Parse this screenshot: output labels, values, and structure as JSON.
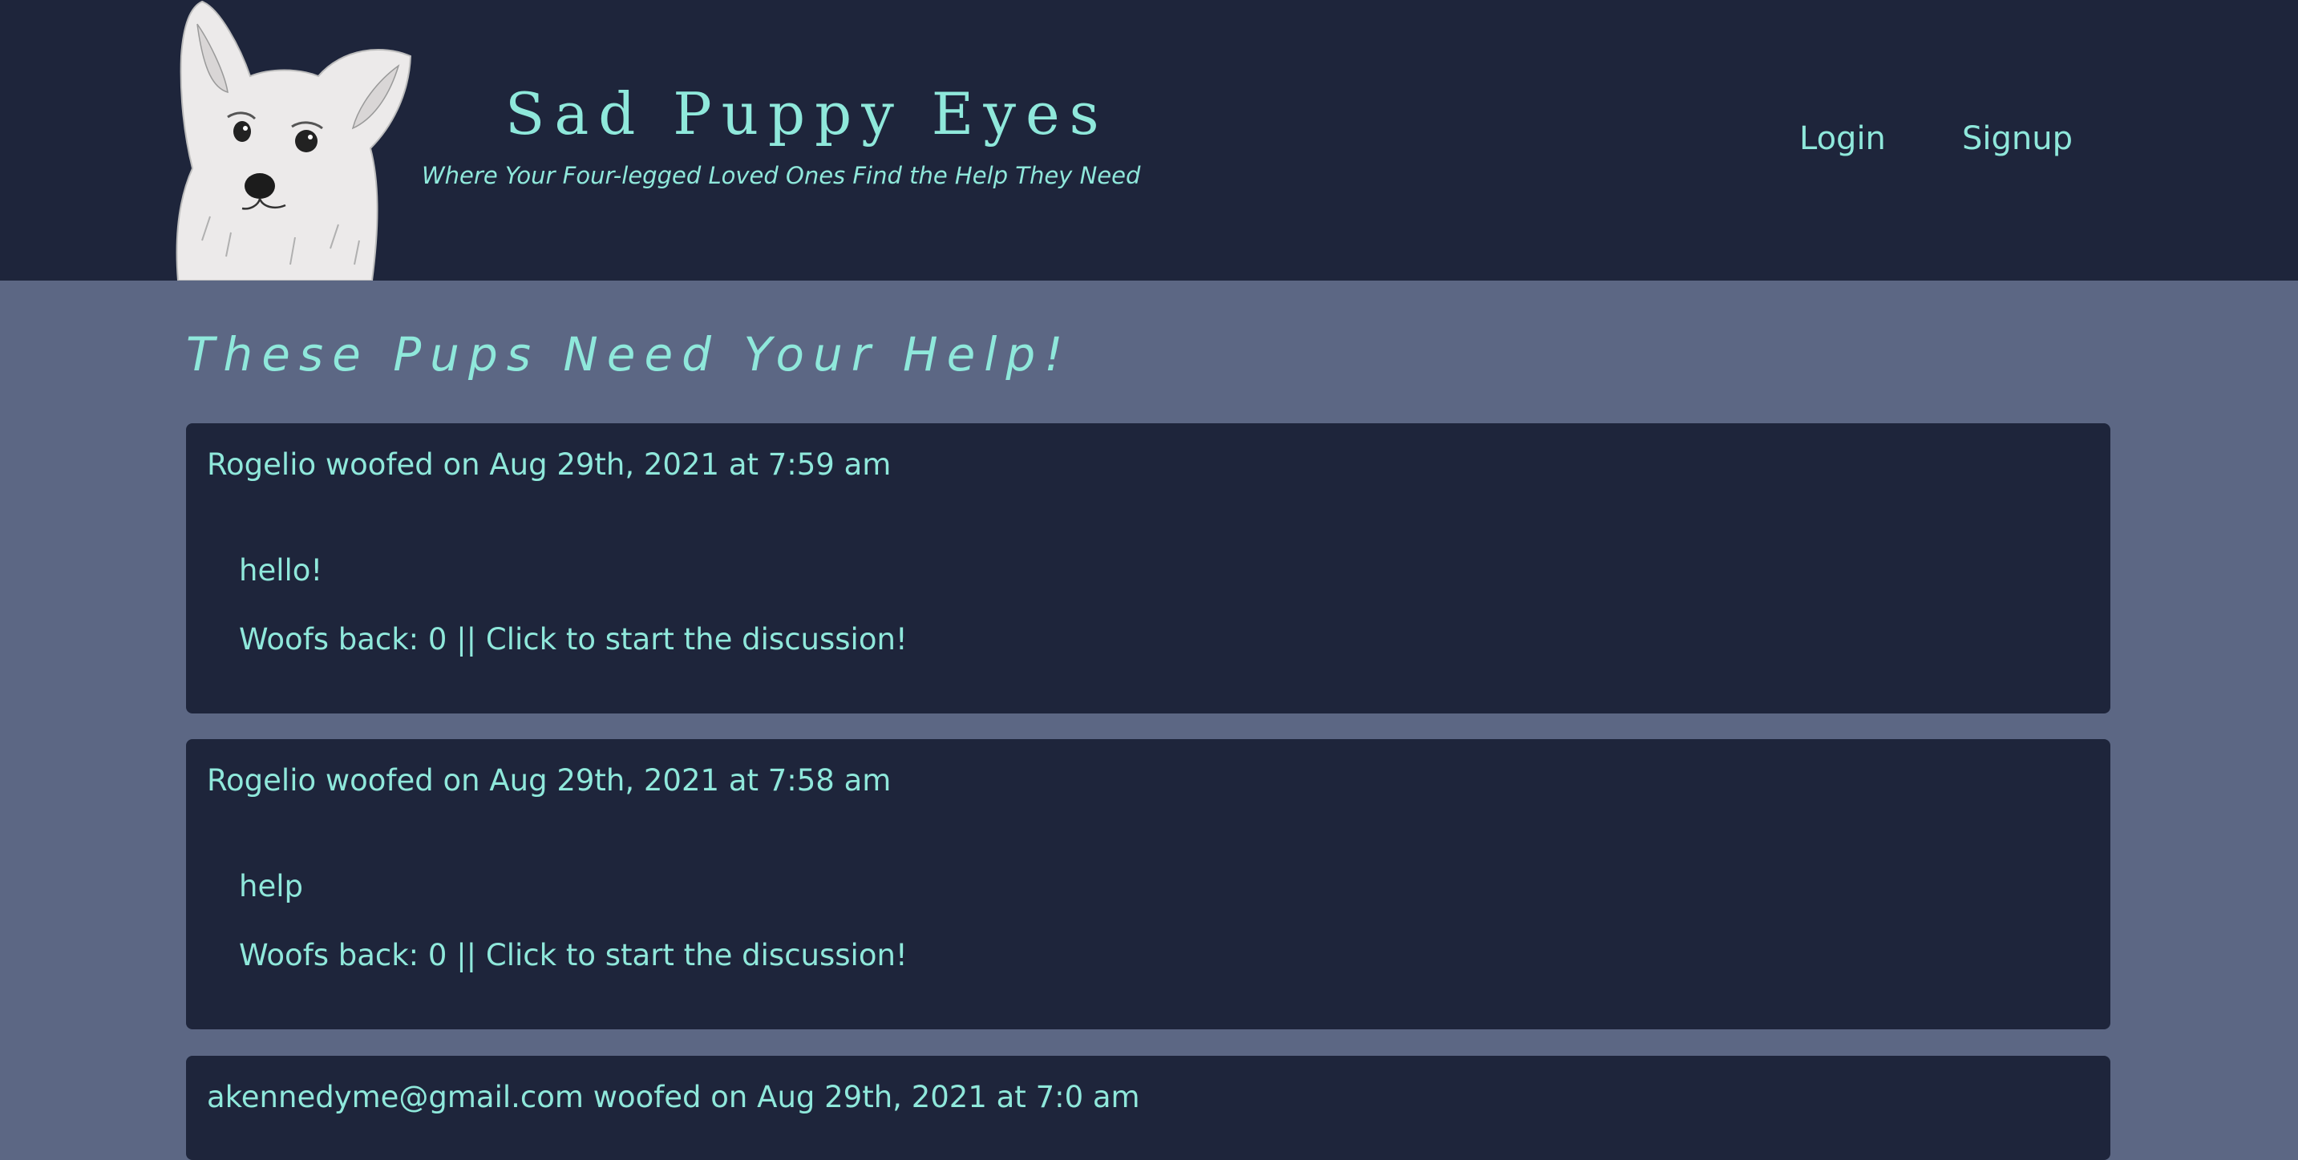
{
  "header": {
    "title": "Sad Puppy Eyes",
    "tagline": "Where Your Four-legged Loved Ones Find the Help They Need",
    "logo_icon": "corgi-drawing-icon",
    "nav": {
      "login": "Login",
      "signup": "Signup"
    }
  },
  "main": {
    "heading": "These Pups Need Your Help!",
    "posts": [
      {
        "author": "Rogelio",
        "meta": " woofed on Aug 29th, 2021 at 7:59 am",
        "body": "hello!",
        "discussion": "Woofs back: 0 || Click to start the discussion!"
      },
      {
        "author": "Rogelio",
        "meta": " woofed on Aug 29th, 2021 at 7:58 am",
        "body": "help",
        "discussion": "Woofs back: 0 || Click to start the discussion!"
      },
      {
        "author": "akennedyme@gmail.com",
        "meta": " woofed on Aug 29th, 2021 at 7:0 am"
      }
    ]
  },
  "colors": {
    "header_bg": "#1e253b",
    "page_bg": "#5c6784",
    "card_bg": "#1e253b",
    "accent": "#8fe8db"
  }
}
